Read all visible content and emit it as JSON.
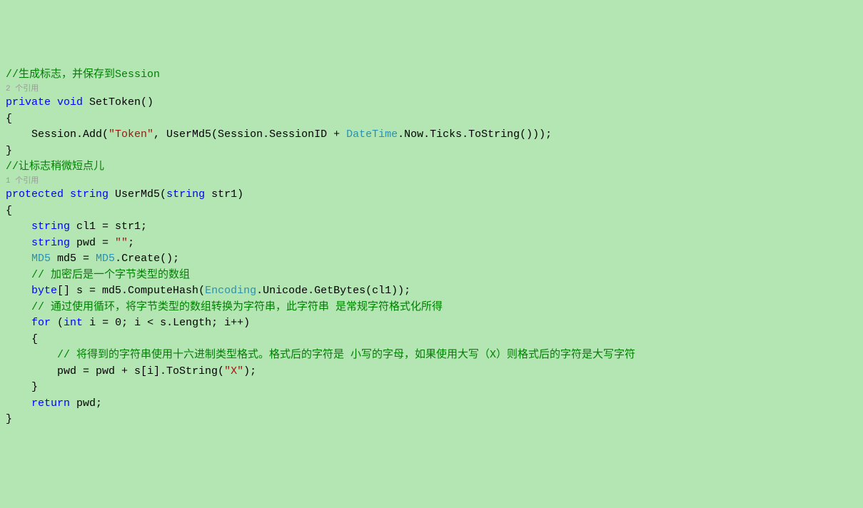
{
  "lines": {
    "l1": "//生成标志，并保存到Session",
    "l2": "2 个引用",
    "l3a": "private",
    "l3b": " ",
    "l3c": "void",
    "l3d": " SetToken()",
    "l4": "{",
    "l5a": "    Session.Add(",
    "l5b": "\"Token\"",
    "l5c": ", UserMd5(Session.SessionID + ",
    "l5d": "DateTime",
    "l5e": ".Now.Ticks.ToString()));",
    "l6": "}",
    "l7": "",
    "l8": "//让标志稍微短点儿",
    "l9": "1 个引用",
    "l10a": "protected",
    "l10b": " ",
    "l10c": "string",
    "l10d": " UserMd5(",
    "l10e": "string",
    "l10f": " str1)",
    "l11": "{",
    "l12a": "    ",
    "l12b": "string",
    "l12c": " cl1 = str1;",
    "l13a": "    ",
    "l13b": "string",
    "l13c": " pwd = ",
    "l13d": "\"\"",
    "l13e": ";",
    "l14a": "    ",
    "l14b": "MD5",
    "l14c": " md5 = ",
    "l14d": "MD5",
    "l14e": ".Create();",
    "l15": "    // 加密后是一个字节类型的数组",
    "l16a": "    ",
    "l16b": "byte",
    "l16c": "[] s = md5.ComputeHash(",
    "l16d": "Encoding",
    "l16e": ".Unicode.GetBytes(cl1));",
    "l17": "    // 通过使用循环，将字节类型的数组转换为字符串，此字符串 是常规字符格式化所得",
    "l18a": "    ",
    "l18b": "for",
    "l18c": " (",
    "l18d": "int",
    "l18e": " i = 0; i < s.Length; i++)",
    "l19": "    {",
    "l20": "        // 将得到的字符串使用十六进制类型格式。格式后的字符是 小写的字母，如果使用大写（X）则格式后的字符是大写字符",
    "l21a": "        pwd = pwd + s[i].ToString(",
    "l21b": "\"X\"",
    "l21c": ");",
    "l22": "    }",
    "l23a": "    ",
    "l23b": "return",
    "l23c": " pwd;",
    "l24": "}"
  }
}
